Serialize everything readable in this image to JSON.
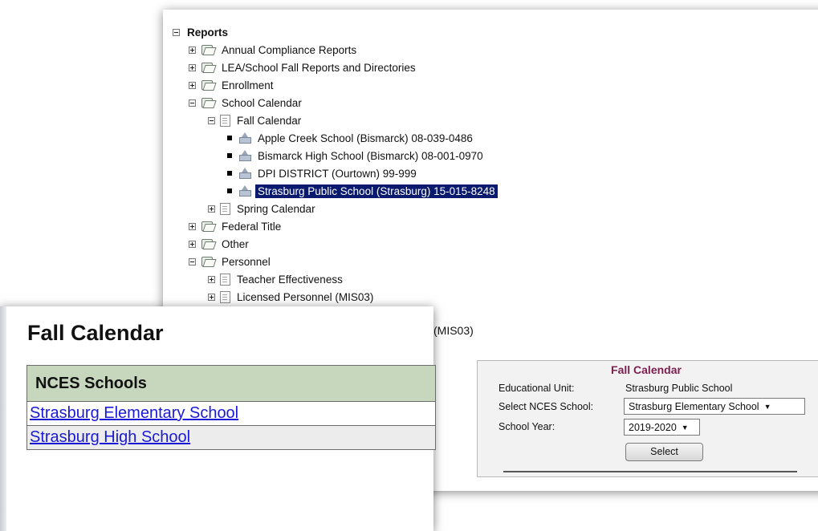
{
  "tree": {
    "root_label": "Reports",
    "annual": "Annual Compliance Reports",
    "lea": "LEA/School Fall Reports and Directories",
    "enrollment": "Enrollment",
    "school_calendar": "School Calendar",
    "fall_calendar": "Fall Calendar",
    "schools": [
      "Apple Creek School (Bismarck) 08-039-0486",
      "Bismarck High School (Bismarck) 08-001-0970",
      "DPI DISTRICT (Ourtown) 99-999",
      "Strasburg Public School (Strasburg) 15-015-8248"
    ],
    "spring_calendar": "Spring Calendar",
    "federal_title": "Federal Title",
    "other": "Other",
    "personnel": "Personnel",
    "teacher_effectiveness": "Teacher Effectiveness",
    "licensed_personnel": "Licensed Personnel (MIS03)",
    "hidden_fragment": "(MIS03)"
  },
  "fall_panel": {
    "title": "Fall Calendar",
    "table_header": "NCES Schools",
    "rows": [
      "Strasburg Elementary School",
      "Strasburg High School"
    ]
  },
  "form": {
    "title": "Fall Calendar",
    "educational_unit_label": "Educational Unit:",
    "educational_unit_value": "Strasburg Public School",
    "nces_label": "Select NCES School:",
    "nces_value": "Strasburg Elementary School",
    "year_label": "School Year:",
    "year_value": "2019-2020",
    "button": "Select"
  },
  "colors": {
    "selected_bg": "#0a1a6e",
    "header_green": "#c6d7bd",
    "link_blue": "#1a1ad6",
    "form_title": "#7b1f4f"
  }
}
